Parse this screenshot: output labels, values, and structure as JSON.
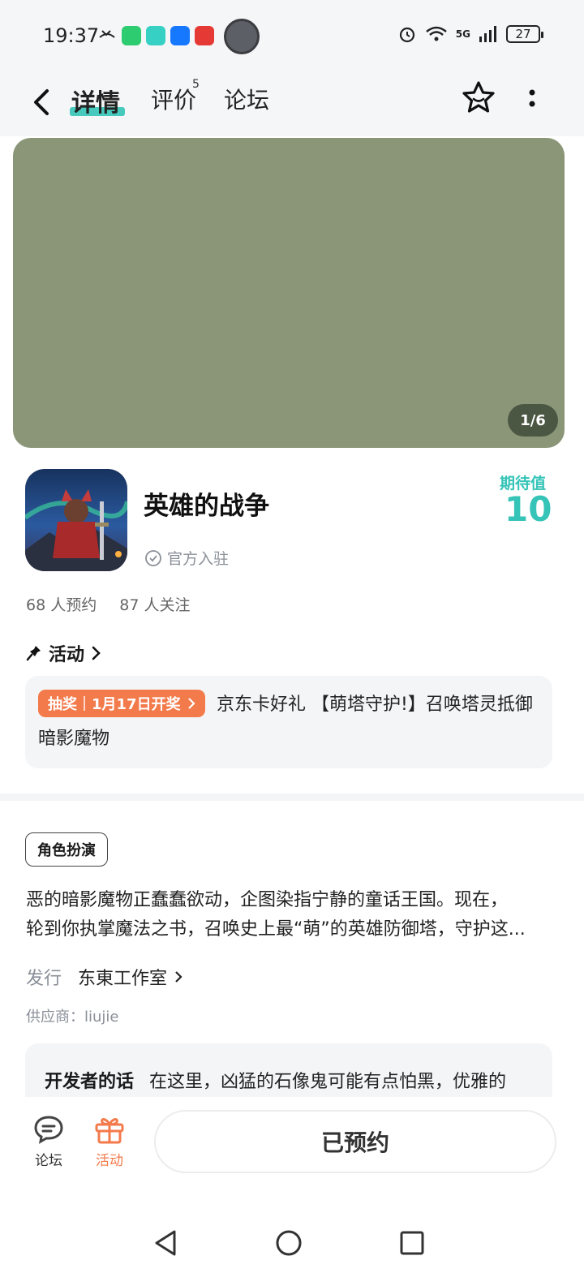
{
  "status_bar": {
    "time": "19:37",
    "battery": "27",
    "network": "5G"
  },
  "nav": {
    "tabs": [
      {
        "label": "详情"
      },
      {
        "label": "评价"
      },
      {
        "label": "论坛"
      }
    ],
    "review_count": "5"
  },
  "hero": {
    "counter": "1/6"
  },
  "game": {
    "title": "英雄的战争",
    "official": "官方入驻",
    "expect_label": "期待值",
    "expect_value": "10",
    "reservations": "68 人预约",
    "followers": "87 人关注"
  },
  "activity": {
    "heading": "活动",
    "tag_type": "抽奖",
    "tag_date": "1月17日开奖",
    "text": "京东卡好礼 【萌塔守护!】召唤塔灵抵御暗影魔物"
  },
  "details": {
    "genre": "角色扮演",
    "desc_line1": "恶的暗影魔物正蠢蠢欲动，企图染指宁静的童话王国。现在，",
    "desc_line2": "轮到你执掌魔法之书，召唤史上最“萌”的英雄防御塔，守护这...",
    "publisher_label": "发行",
    "publisher_name": "东東工作室",
    "supplier": "供应商：liujie"
  },
  "developer": {
    "title": "开发者的话",
    "text": "在这里，凶猛的石像鬼可能有点怕黑，优雅的"
  },
  "bottom_bar": {
    "forum_label": "论坛",
    "activity_label": "活动",
    "reserve_label": "已预约"
  },
  "colors": {
    "accent": "#35c4b7",
    "activity_orange": "#f37a4b",
    "hero_bg": "#8a9677"
  }
}
